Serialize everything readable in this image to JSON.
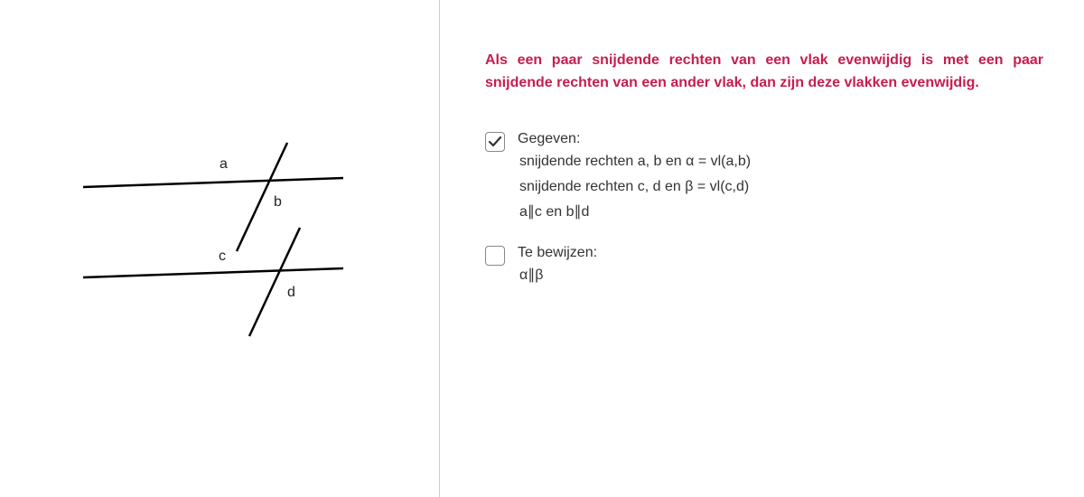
{
  "theorem": "Als een paar snijdende rechten van een vlak evenwijdig is met een paar snijdende rechten van een ander vlak, dan zijn deze vlakken evenwijdig.",
  "diagram": {
    "labels": {
      "a": "a",
      "b": "b",
      "c": "c",
      "d": "d"
    }
  },
  "sections": {
    "given": {
      "checked": true,
      "title": "Gegeven:",
      "lines": [
        "snijdende rechten a, b en α = vl(a,b)",
        "snijdende rechten c, d en β = vl(c,d)",
        "a∥c en b∥d"
      ]
    },
    "toprove": {
      "checked": false,
      "title": "Te bewijzen:",
      "lines": [
        "α∥β"
      ]
    }
  }
}
